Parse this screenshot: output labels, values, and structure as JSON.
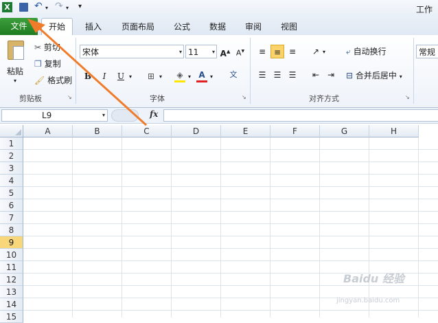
{
  "window": {
    "title": "工作簿"
  },
  "tabs": [
    "文件",
    "开始",
    "插入",
    "页面布局",
    "公式",
    "数据",
    "审阅",
    "视图"
  ],
  "clipboard": {
    "paste": "粘贴",
    "cut": "剪切",
    "copy": "复制",
    "format_painter": "格式刷",
    "group": "剪贴板"
  },
  "font": {
    "name": "宋体",
    "size": "11",
    "group": "字体"
  },
  "alignment": {
    "wrap": "自动换行",
    "merge": "合并后居中",
    "group": "对齐方式"
  },
  "number": {
    "format": "常规"
  },
  "formula_bar": {
    "name_box": "L9",
    "fx": "fx"
  },
  "columns": [
    "A",
    "B",
    "C",
    "D",
    "E",
    "F",
    "G",
    "H"
  ],
  "rows": [
    "1",
    "2",
    "3",
    "4",
    "5",
    "6",
    "7",
    "8",
    "9",
    "10",
    "11",
    "12",
    "13",
    "14",
    "15"
  ],
  "selected_row": "9",
  "watermark": {
    "brand": "Baidu 经验",
    "url": "jingyan.baidu.com"
  },
  "colors": {
    "file_tab": "#2a8a2a",
    "arrow": "#f07b2a",
    "selected_row": "#f7d77a"
  }
}
